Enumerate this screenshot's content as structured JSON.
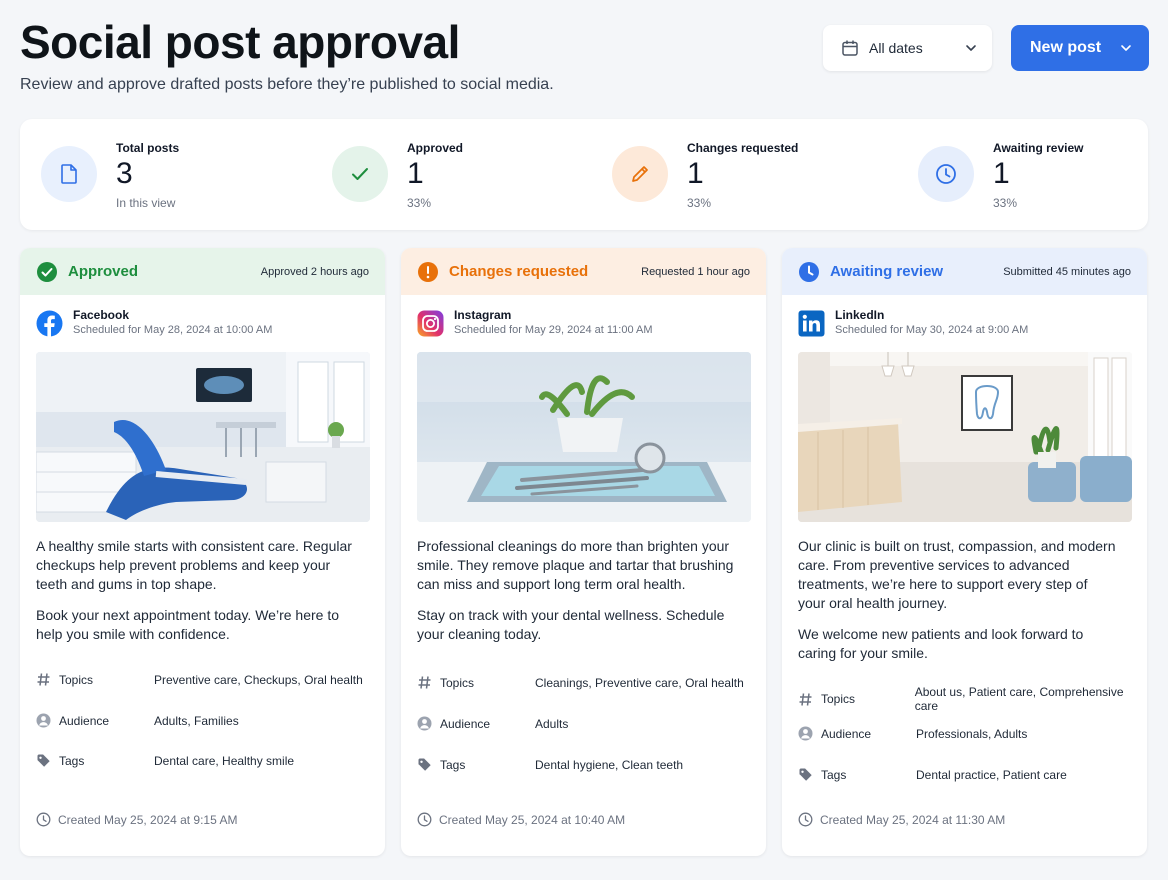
{
  "header": {
    "title": "Social post approval",
    "subtitle": "Review and approve drafted posts before they’re published to social media."
  },
  "toolbar": {
    "date_filter": "All dates",
    "new_post": "New post"
  },
  "stats": [
    {
      "label": "Total posts",
      "value": "3",
      "sub": "In this view",
      "icon": "document-icon"
    },
    {
      "label": "Approved",
      "value": "1",
      "sub": "33%",
      "icon": "check-icon"
    },
    {
      "label": "Changes requested",
      "value": "1",
      "sub": "33%",
      "icon": "pencil-icon"
    },
    {
      "label": "Awaiting review",
      "value": "1",
      "sub": "33%",
      "icon": "clock-icon"
    }
  ],
  "colors": {
    "primary": "#2f6fe6",
    "approved": "#1e8e3e",
    "changes": "#e8710a",
    "awaiting": "#2f6fe6"
  },
  "meta_labels": {
    "topics": "Topics",
    "audience": "Audience",
    "tags": "Tags"
  },
  "posts": [
    {
      "status": "Approved",
      "when": "Approved 2 hours ago",
      "platform": "Facebook",
      "scheduled": "Scheduled for May 28, 2024 at 10:00 AM",
      "paragraphs": [
        "A healthy smile starts with consistent care. Regular checkups help prevent problems and keep your teeth and gums in top shape.",
        "Book your next appointment today. We’re here to help you smile with confidence."
      ],
      "topics": "Preventive care, Checkups, Oral health",
      "audience": "Adults, Families",
      "tags": "Dental care, Healthy smile",
      "created": "Created May 25, 2024 at 9:15 AM"
    },
    {
      "status": "Changes requested",
      "when": "Requested 1 hour ago",
      "platform": "Instagram",
      "scheduled": "Scheduled for May 29, 2024 at 11:00 AM",
      "paragraphs": [
        "Professional cleanings do more than brighten your smile. They remove plaque and tartar that brushing can miss and support long term oral health.",
        "Stay on track with your dental wellness. Schedule your cleaning today."
      ],
      "topics": "Cleanings, Preventive care, Oral health",
      "audience": "Adults",
      "tags": "Dental hygiene, Clean teeth",
      "created": "Created May 25, 2024 at 10:40 AM"
    },
    {
      "status": "Awaiting review",
      "when": "Submitted 45 minutes ago",
      "platform": "LinkedIn",
      "scheduled": "Scheduled for May 30, 2024 at 9:00 AM",
      "paragraphs": [
        "Our clinic is built on trust, compassion, and modern care. From preventive services to advanced treatments, we’re here to support every step of your oral health journey.",
        "We welcome new patients and look forward to caring for your smile."
      ],
      "topics": "About us, Patient care, Comprehensive care",
      "audience": "Professionals, Adults",
      "tags": "Dental practice, Patient care",
      "created": "Created May 25, 2024 at 11:30 AM"
    }
  ]
}
